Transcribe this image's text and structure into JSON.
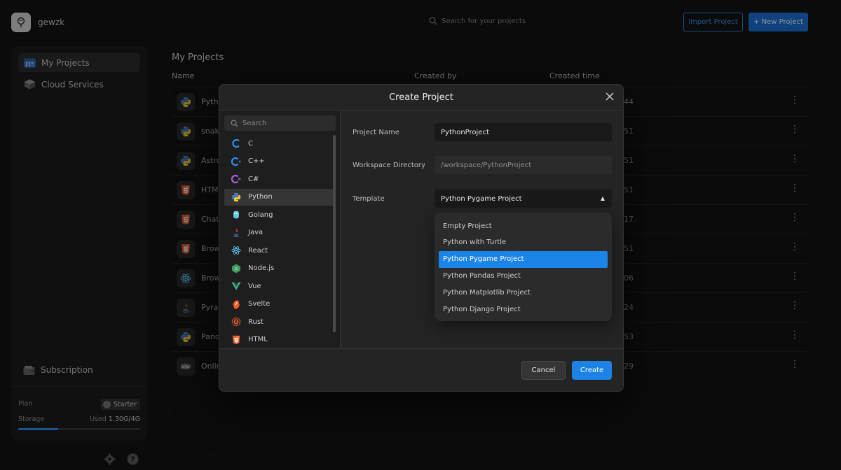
{
  "header": {
    "username": "gewzk",
    "search_placeholder": "Search for your projects",
    "import_label": "Import Project",
    "new_label": "+ New Project"
  },
  "sidebar": {
    "items": [
      {
        "label": "My Projects",
        "icon": "calendar-icon",
        "active": true
      },
      {
        "label": "Cloud Services",
        "icon": "cube-icon",
        "active": false
      }
    ],
    "subscription_label": "Subscription",
    "plan_label": "Plan",
    "plan_value": "Starter",
    "storage_label": "Storage",
    "storage_used_prefix": "Used",
    "storage_used_value": "1.30G/4G",
    "storage_fraction": 0.325
  },
  "main": {
    "title": "My Projects",
    "columns": [
      "Name",
      "Created by",
      "Created time"
    ],
    "rows": [
      {
        "icon": "python-icon",
        "name": "Pytho",
        "time_tail": "44"
      },
      {
        "icon": "python-icon",
        "name": "snak",
        "time_tail": "51"
      },
      {
        "icon": "python-icon",
        "name": "Astro",
        "time_tail": "51"
      },
      {
        "icon": "html-icon",
        "name": "HTM",
        "time_tail": "51"
      },
      {
        "icon": "html-icon",
        "name": "Chat",
        "time_tail": "17"
      },
      {
        "icon": "html-icon",
        "name": "Brow",
        "time_tail": "51"
      },
      {
        "icon": "react-icon",
        "name": "Brow",
        "time_tail": "06"
      },
      {
        "icon": "java-icon",
        "name": "Pyra",
        "time_tail": "24"
      },
      {
        "icon": "python-icon",
        "name": "Pand",
        "time_tail": "53"
      },
      {
        "icon": "php-icon",
        "name": "Onlin",
        "time_tail": "29"
      }
    ]
  },
  "modal": {
    "title": "Create Project",
    "search_placeholder": "Search",
    "languages": [
      {
        "label": "C",
        "icon": "c-icon"
      },
      {
        "label": "C++",
        "icon": "cpp-icon"
      },
      {
        "label": "C#",
        "icon": "csharp-icon"
      },
      {
        "label": "Python",
        "icon": "python-icon",
        "selected": true
      },
      {
        "label": "Golang",
        "icon": "golang-icon"
      },
      {
        "label": "Java",
        "icon": "java-icon"
      },
      {
        "label": "React",
        "icon": "react-icon"
      },
      {
        "label": "Node.js",
        "icon": "nodejs-icon"
      },
      {
        "label": "Vue",
        "icon": "vue-icon"
      },
      {
        "label": "Svelte",
        "icon": "svelte-icon"
      },
      {
        "label": "Rust",
        "icon": "rust-icon"
      },
      {
        "label": "HTML",
        "icon": "html-icon"
      }
    ],
    "project_name_label": "Project Name",
    "project_name_value": "PythonProject",
    "workspace_label": "Workspace Directory",
    "workspace_value": "/workspace/PythonProject",
    "template_label": "Template",
    "template_value": "Python Pygame Project",
    "template_options": [
      "Empty Project",
      "Python with Turtle",
      "Python Pygame Project",
      "Python Pandas Project",
      "Python Matplotlib Project",
      "Python Django Project"
    ],
    "template_selected_index": 2,
    "cancel_label": "Cancel",
    "create_label": "Create"
  },
  "colors": {
    "accent": "#1c82e6",
    "background": "#131313",
    "modal": "#242424"
  }
}
